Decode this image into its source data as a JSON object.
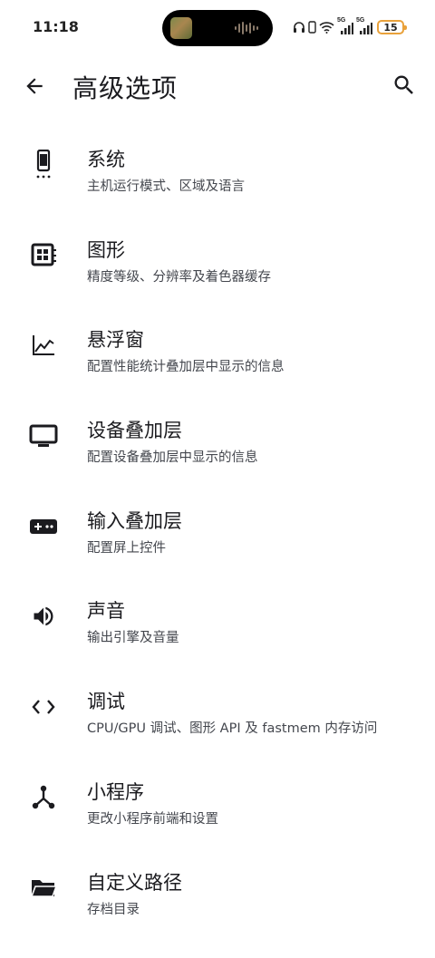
{
  "status_bar": {
    "time": "11:18",
    "signal1_label": "5G",
    "signal2_label": "5G",
    "battery": "15",
    "icons": [
      "audio-waveform-icon",
      "headphones-icon",
      "vibrate-icon",
      "wifi-icon",
      "signal-icon",
      "signal-icon",
      "battery-icon"
    ]
  },
  "app_bar": {
    "title": "高级选项",
    "back_icon": "arrow-back-icon",
    "search_icon": "search-icon"
  },
  "items": [
    {
      "title": "系统",
      "subtitle": "主机运行模式、区域及语言",
      "icon": "phone-icon"
    },
    {
      "title": "图形",
      "subtitle": "精度等级、分辨率及着色器缓存",
      "icon": "chip-icon"
    },
    {
      "title": "悬浮窗",
      "subtitle": "配置性能统计叠加层中显示的信息",
      "icon": "chart-icon"
    },
    {
      "title": "设备叠加层",
      "subtitle": "配置设备叠加层中显示的信息",
      "icon": "monitor-icon"
    },
    {
      "title": "输入叠加层",
      "subtitle": "配置屏上控件",
      "icon": "gamepad-icon"
    },
    {
      "title": "声音",
      "subtitle": "输出引擎及音量",
      "icon": "volume-icon"
    },
    {
      "title": "调试",
      "subtitle": "CPU/GPU 调试、图形 API 及 fastmem 内存访问",
      "icon": "code-icon"
    },
    {
      "title": "小程序",
      "subtitle": "更改小程序前端和设置",
      "icon": "applet-icon"
    },
    {
      "title": "自定义路径",
      "subtitle": "存档目录",
      "icon": "folder-icon"
    }
  ],
  "colors": {
    "text_primary": "#1b1b1f",
    "text_secondary": "#44474e",
    "battery_accent": "#e9a13a",
    "background": "#ffffff"
  }
}
